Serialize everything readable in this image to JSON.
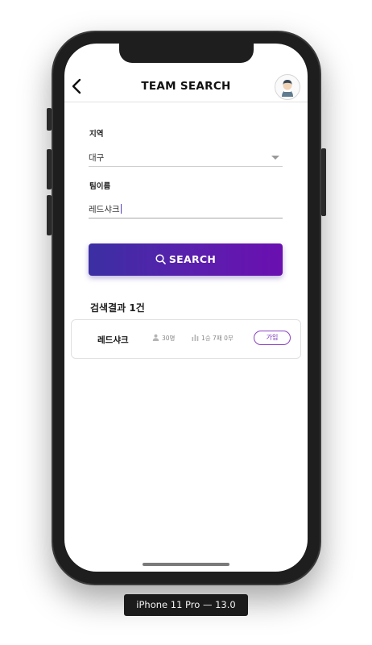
{
  "header": {
    "title": "TEAM SEARCH",
    "back_icon": "chevron-left-icon",
    "avatar_icon": "user-avatar-icon"
  },
  "form": {
    "region": {
      "label": "지역",
      "value": "대구"
    },
    "team_name": {
      "label": "팀이름",
      "value": "레드샤크"
    }
  },
  "search_button": {
    "label": "SEARCH",
    "icon": "search-icon",
    "colors": {
      "from": "#3b2fa3",
      "to": "#6a0fb0"
    }
  },
  "results": {
    "label_prefix": "검색결과 ",
    "count": "1",
    "label_suffix": "건",
    "items": [
      {
        "team": "레드샤크",
        "members": "30명",
        "record": "1승 7패 0무",
        "join_label": "가입"
      }
    ]
  },
  "device": {
    "caption": "iPhone 11 Pro — 13.0"
  }
}
